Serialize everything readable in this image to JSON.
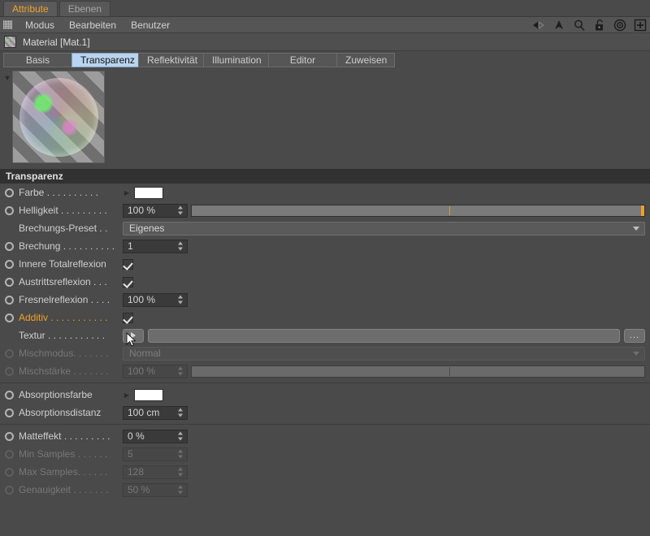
{
  "window_tabs": [
    {
      "label": "Attribute",
      "active": true
    },
    {
      "label": "Ebenen",
      "active": false
    }
  ],
  "menubar": {
    "grip_icon": "grip-dots-icon",
    "items": [
      "Modus",
      "Bearbeiten",
      "Benutzer"
    ],
    "icons": [
      "back-arrow-icon",
      "up-arrow-icon",
      "magnifier-icon",
      "unlock-icon",
      "target-icon",
      "plus-icon"
    ]
  },
  "object_header": {
    "icon": "material-swatch-icon",
    "title": "Material [Mat.1]"
  },
  "channel_tabs": [
    {
      "label": "Basis",
      "active": false
    },
    {
      "label": "Transparenz",
      "active": true
    },
    {
      "label": "Reflektivität",
      "active": false
    },
    {
      "label": "Illumination",
      "active": false
    },
    {
      "label": "Editor",
      "active": false
    },
    {
      "label": "Zuweisen",
      "active": false
    }
  ],
  "preview": {
    "collapse_icon": "triangle-down-icon",
    "image": "soap-bubble-material-preview"
  },
  "section": {
    "title": "Transparenz"
  },
  "rows": {
    "farbe": {
      "label": "Farbe",
      "dots": " . . . . . . . . . .",
      "color": "#ffffff"
    },
    "helligkeit": {
      "label": "Helligkeit",
      "dots": " . . . . . . . . .",
      "value": "100 %"
    },
    "brechungs_preset": {
      "label": "Brechungs-Preset",
      "dots": " . .",
      "value": "Eigenes"
    },
    "brechung": {
      "label": "Brechung",
      "dots": " . . . . . . . . . .",
      "value": "1"
    },
    "innere_totalreflexion": {
      "label": "Innere Totalreflexion",
      "dots": "",
      "checked": true
    },
    "austrittsreflexion": {
      "label": "Austrittsreflexion",
      "dots": " . . .",
      "checked": true
    },
    "fresnelreflexion": {
      "label": "Fresnelreflexion",
      "dots": " . . . .",
      "value": "100 %"
    },
    "additiv": {
      "label": "Additiv",
      "dots": " . . . . . . . . . . .",
      "checked": true,
      "highlight_color": "#f0a027"
    },
    "textur": {
      "label": "Textur",
      "dots": " . . . . . . . . . . .",
      "value": "",
      "browse_label": "..."
    },
    "mischmodus": {
      "label": "Mischmodus",
      "dots": ". . . . . . .",
      "value": "Normal"
    },
    "mischstaerke": {
      "label": "Mischstärke",
      "dots": " . . . . . . .",
      "value": "100 %"
    },
    "absorptionsfarbe": {
      "label": "Absorptionsfarbe",
      "dots": "",
      "color": "#ffffff"
    },
    "absorptionsdistanz": {
      "label": "Absorptionsdistanz",
      "dots": "",
      "value": "100 cm"
    },
    "matteffekt": {
      "label": "Matteffekt",
      "dots": " . . . . . . . . .",
      "value": "0 %"
    },
    "min_samples": {
      "label": "Min Samples",
      "dots": " . . . . . .",
      "value": "5"
    },
    "max_samples": {
      "label": "Max Samples",
      "dots": ". . . . . .",
      "value": "128"
    },
    "genauigkeit": {
      "label": "Genauigkeit",
      "dots": " . . . . . . .",
      "value": "50 %"
    }
  }
}
